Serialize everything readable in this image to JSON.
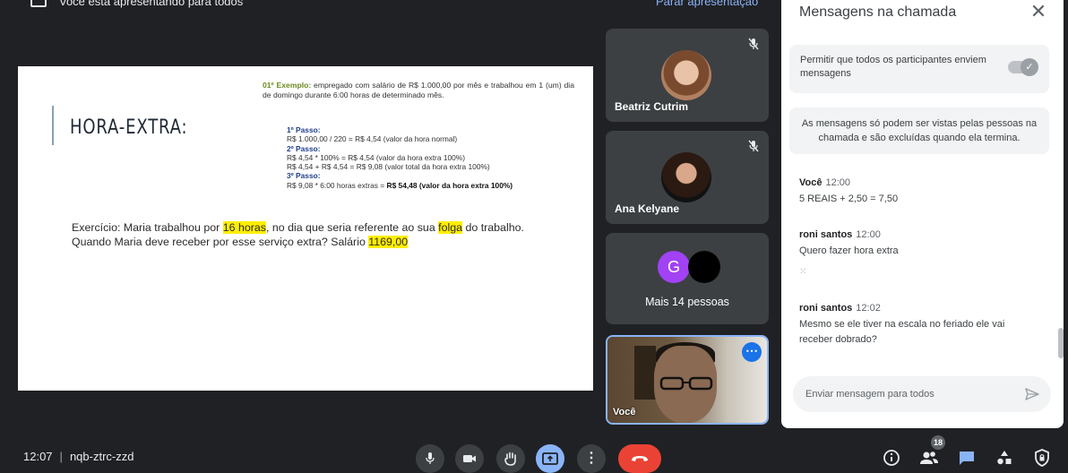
{
  "banner": {
    "text": "Você está apresentando para todos",
    "stop_label": "Parar apresentação"
  },
  "slide": {
    "title": "HORA-EXTRA:",
    "example": {
      "label": "01º Exemplo:",
      "text": " empregado com salário de R$ 1.000,00 por mês e trabalhou em 1 (um) dia de domingo durante 6:00 horas de determinado mês."
    },
    "steps": {
      "step1_title": "1º Passo:",
      "step1_line1": "R$ 1.000,00 / 220 = R$ 4,54 (valor da hora normal)",
      "step2_title": "2º Passo:",
      "step2_line1": "R$ 4,54 * 100% = R$ 4,54 (valor da hora extra 100%)",
      "step2_line2": "R$ 4,54 + R$ 4,54 = R$ 9,08 (valor total da hora extra 100%)",
      "step3_title": "3º Passo:",
      "step3_line1_a": "R$ 9,08 * 6:00 horas extras = ",
      "step3_line1_b": "R$ 54,48 (valor da hora extra 100%)"
    },
    "exercise": {
      "part1": "Exercício: Maria trabalhou por ",
      "hl1": "16 horas",
      "part2": ", no dia que seria referente ao sua ",
      "hl2": "folga",
      "part3": " do trabalho. Quando Maria deve receber por esse serviço extra? Salário ",
      "hl3": "1169,00"
    }
  },
  "participants": [
    {
      "name": "Beatriz Cutrim"
    },
    {
      "name": "Ana Kelyane"
    }
  ],
  "more_people": {
    "avatar_letter": "G",
    "label": "Mais 14 pessoas"
  },
  "self_tile": {
    "label": "Você",
    "more_icon": "more-vert-icon"
  },
  "chat": {
    "title": "Mensagens na chamada",
    "setting_label": "Permitir que todos os participantes enviem mensagens",
    "info": "As mensagens só podem ser vistas pelas pessoas na chamada e são excluídas quando ela termina.",
    "messages": [
      {
        "sender": "Você",
        "time": "12:00",
        "lines": [
          "5 REAIS + 2,50 = 7,50"
        ]
      },
      {
        "sender": "roni santos",
        "time": "12:00",
        "lines": [
          "Quero fazer hora extra",
          "⁙"
        ]
      },
      {
        "sender": "roni santos",
        "time": "12:02",
        "lines": [
          "Mesmo se ele tiver na escala no feriado ele vai",
          "receber dobrado?"
        ]
      }
    ],
    "input_placeholder": "Enviar mensagem para todos"
  },
  "bottom": {
    "time": "12:07",
    "meeting_code": "nqb-ztrc-zzd",
    "people_count": "18"
  },
  "colors": {
    "background": "#202124",
    "accent_blue": "#8ab4f8",
    "hangup_red": "#ea4335",
    "highlight": "#ffee00"
  }
}
